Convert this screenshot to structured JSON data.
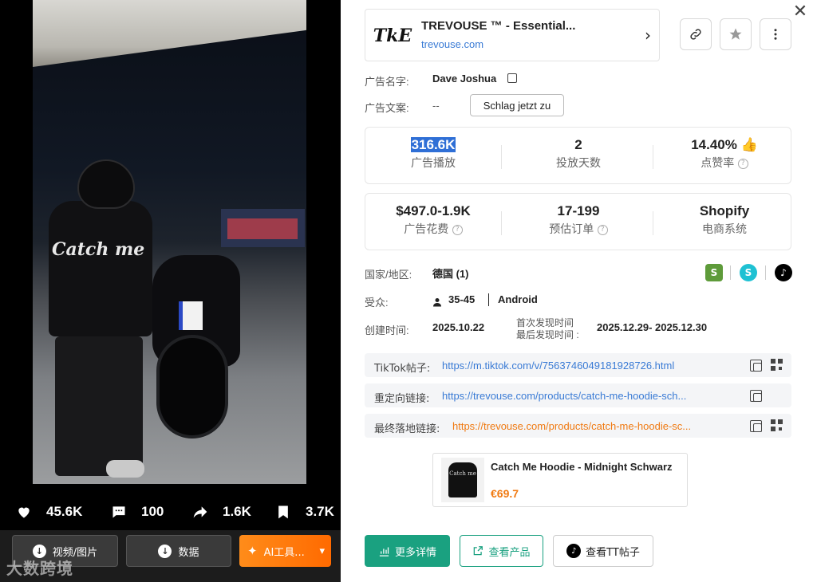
{
  "left": {
    "video_overlay_text": "Catch me",
    "stats": {
      "likes": "45.6K",
      "comments": "100",
      "shares": "1.6K",
      "saves": "3.7K"
    },
    "actions": {
      "download_media": "视频/图片",
      "download_data": "数据",
      "ai_tools": "AI工具...",
      "ai_dropdown": "▾"
    },
    "watermark": "大数跨境"
  },
  "shop": {
    "logo_text": "TkE",
    "title": "TREVOUSE ™ - Essential...",
    "url": "trevouse.com",
    "chevron": "›"
  },
  "toolbar": {
    "link_icon": "link-icon",
    "star_icon": "star-icon",
    "more_icon": "more-icon"
  },
  "ad_info": {
    "ad_name_label": "广告名字:",
    "ad_name": "Dave Joshua",
    "ad_copy_label": "广告文案:",
    "ad_copy": "--",
    "cta": "Schlag jetzt zu"
  },
  "metrics_row1": [
    {
      "value": "316.6K",
      "label": "广告播放"
    },
    {
      "value": "2",
      "label": "投放天数"
    },
    {
      "value": "14.40%",
      "label": "点赞率"
    }
  ],
  "metrics_row2": [
    {
      "value": "$497.0-1.9K",
      "label": "广告花费"
    },
    {
      "value": "17-199",
      "label": "预估订单"
    },
    {
      "value": "Shopify",
      "label": "电商系统"
    }
  ],
  "details": {
    "region_label": "国家/地区:",
    "region": "德国 (1)",
    "audience_label": "受众:",
    "age": "35-45",
    "device": "Android",
    "created_label": "创建时间:",
    "created": "2025.10.22",
    "first_seen_label": "首次发现时间",
    "last_seen_label": "最后发现时间 :",
    "seen_range": "2025.12.29- 2025.12.30"
  },
  "links": [
    {
      "label": "TikTok帖子:",
      "url": "https://m.tiktok.com/v/7563746049181928726.html"
    },
    {
      "label": "重定向链接:",
      "url": "https://trevouse.com/products/catch-me-hoodie-sch..."
    },
    {
      "label": "最终落地链接:",
      "url": "https://trevouse.com/products/catch-me-hoodie-sc..."
    }
  ],
  "product": {
    "name": "Catch Me Hoodie - Midnight Schwarz",
    "price": "€69.7",
    "thumb_text": "Catch me"
  },
  "buttons": {
    "more_details": "更多详情",
    "view_product": "查看产品",
    "view_tiktok": "查看TT帖子"
  },
  "colors": {
    "accent_green": "#1aa180",
    "accent_orange": "#f07a12",
    "link_blue": "#3a7bd5"
  }
}
